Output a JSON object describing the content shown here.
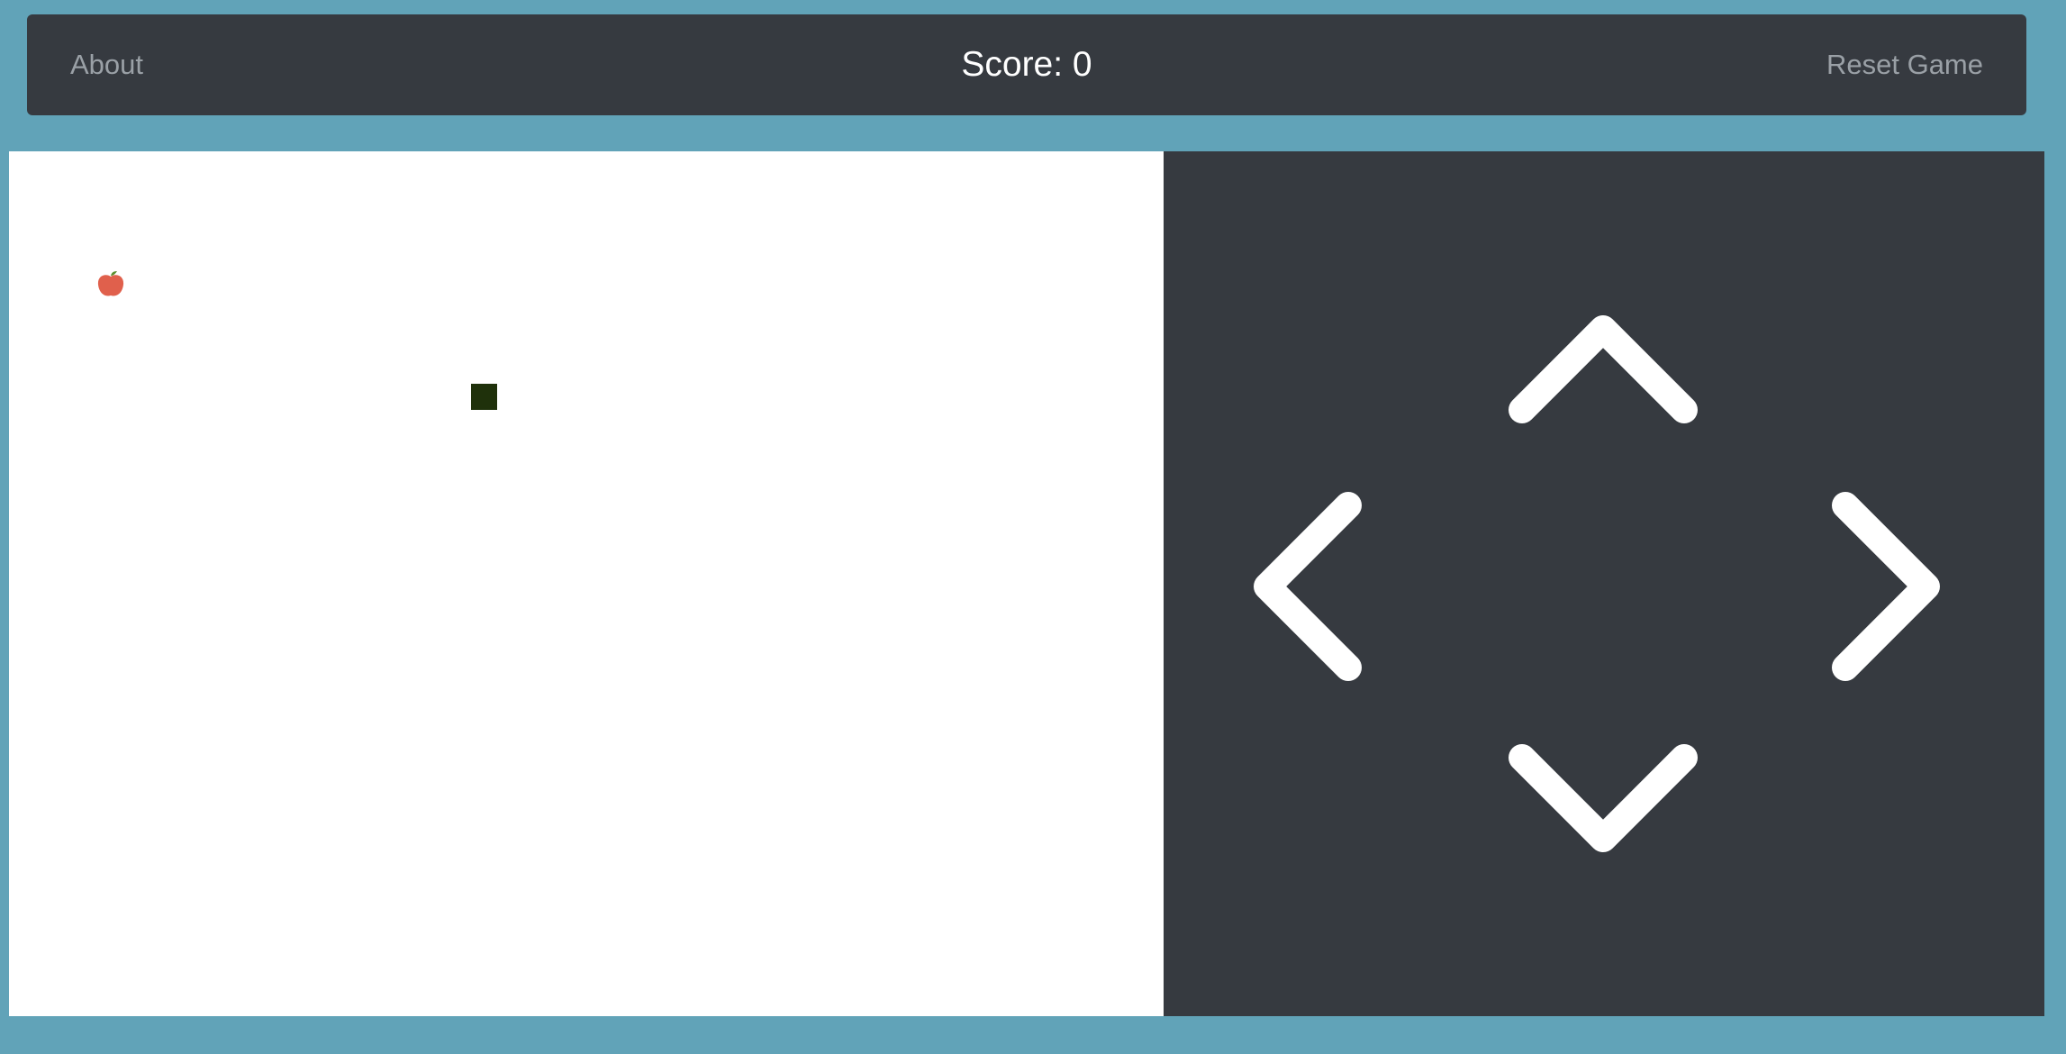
{
  "colors": {
    "page_background": "#61a3b8",
    "navbar_background": "#363a40",
    "nav_link_text": "#9aa0a6",
    "score_text": "#ffffff",
    "board_background": "#ffffff",
    "controls_background": "#363a40",
    "arrow_color": "#ffffff",
    "snake_color": "#1f310b",
    "apple_color": "#e0604c",
    "apple_leaf_color": "#5a8f2e"
  },
  "navbar": {
    "about_label": "About",
    "score_label": "Score:",
    "score_value": "0",
    "reset_label": "Reset Game"
  },
  "game": {
    "apple_icon": "apple-icon",
    "snake_icon": "snake-segment"
  },
  "controls": {
    "up_icon": "chevron-up-icon",
    "left_icon": "chevron-left-icon",
    "right_icon": "chevron-right-icon",
    "down_icon": "chevron-down-icon"
  }
}
